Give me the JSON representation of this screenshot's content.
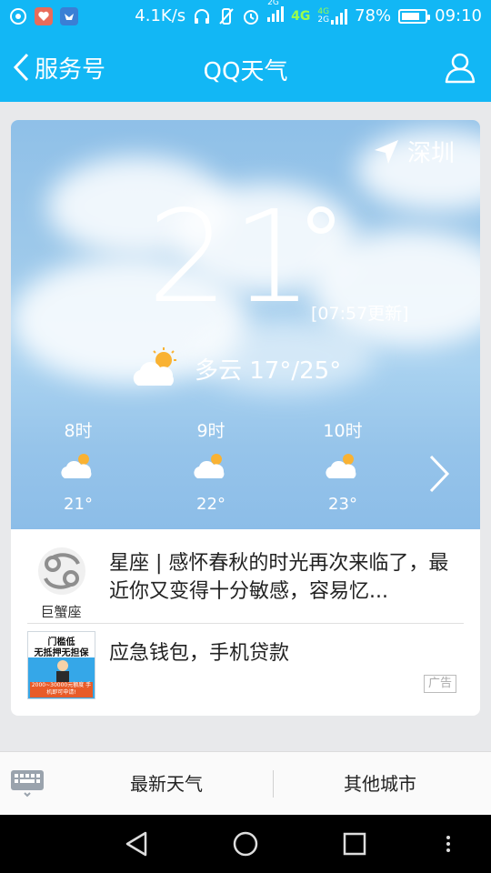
{
  "status_bar": {
    "net_speed": "4.1K/s",
    "battery": "78%",
    "battery_level": 0.78,
    "time": "09:10",
    "network_tag_4g": "4G",
    "network_small_1": "2G",
    "network_small_2": "4G",
    "network_small_3": "2G"
  },
  "header": {
    "back_label": "服务号",
    "title": "QQ天气"
  },
  "weather": {
    "city": "深圳",
    "temperature": "21",
    "updated": "[07:57更新]",
    "condition": "多云 17°/25°",
    "hourly": [
      {
        "time": "8时",
        "temp": "21°"
      },
      {
        "time": "9时",
        "temp": "22°"
      },
      {
        "time": "10时",
        "temp": "23°"
      }
    ]
  },
  "info": {
    "zodiac_label": "巨蟹座",
    "horoscope_text": "星座 | 感怀春秋的时光再次来临了，最近你又变得十分敏感，容易忆...",
    "ad_text": "应急钱包，手机贷款",
    "ad_badge": "广告",
    "ad_image_line1": "门槛低",
    "ad_image_line2": "无抵押无担保",
    "ad_image_band": "2000~30000元额度 手机即可申请!"
  },
  "bottom_tabs": {
    "tab1": "最新天气",
    "tab2": "其他城市"
  },
  "colors": {
    "brand_blue": "#12b7f5",
    "sky_top": "#8fc0e8",
    "sky_bottom": "#a9d2f0"
  },
  "icons": {
    "back": "chevron-left-icon",
    "profile": "person-icon",
    "location": "location-arrow-icon",
    "condition": "partly-cloudy-icon",
    "next": "chevron-right-icon",
    "keyboard": "keyboard-icon"
  }
}
